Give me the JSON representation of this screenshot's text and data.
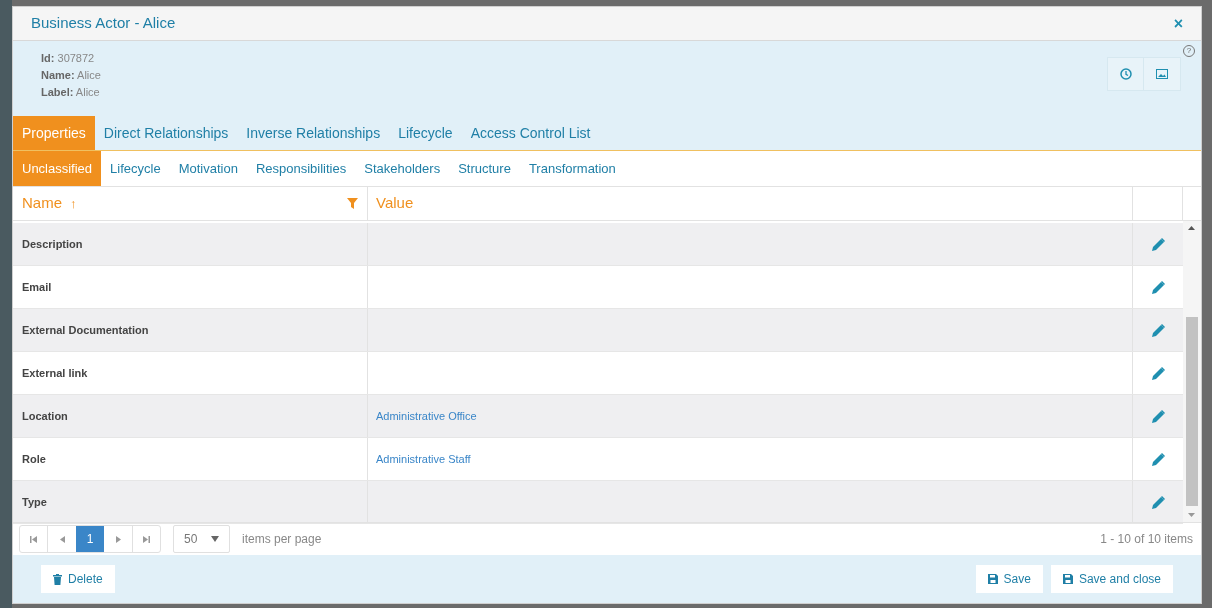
{
  "window": {
    "title": "Business Actor - Alice",
    "close": "×"
  },
  "info": [
    {
      "label": "Id:",
      "value": "307872"
    },
    {
      "label": "Name:",
      "value": "Alice"
    },
    {
      "label": "Label:",
      "value": "Alice"
    }
  ],
  "help": "?",
  "tabs": [
    {
      "label": "Properties",
      "selected": true
    },
    {
      "label": "Direct Relationships",
      "selected": false
    },
    {
      "label": "Inverse Relationships",
      "selected": false
    },
    {
      "label": "Lifecycle",
      "selected": false
    },
    {
      "label": "Access Control List",
      "selected": false
    }
  ],
  "subtabs": [
    {
      "label": "Unclassified",
      "selected": true
    },
    {
      "label": "Lifecycle",
      "selected": false
    },
    {
      "label": "Motivation",
      "selected": false
    },
    {
      "label": "Responsibilities",
      "selected": false
    },
    {
      "label": "Stakeholders",
      "selected": false
    },
    {
      "label": "Structure",
      "selected": false
    },
    {
      "label": "Transformation",
      "selected": false
    }
  ],
  "table": {
    "columns": [
      {
        "label": "Name",
        "sort": "↑"
      },
      {
        "label": "Value"
      }
    ],
    "rows": [
      {
        "name": "Description"
      },
      {
        "name": "Email"
      },
      {
        "name": "External Documentation"
      },
      {
        "name": "External link"
      },
      {
        "name": "Location",
        "value": "Administrative Office"
      },
      {
        "name": "Role",
        "value": "Administrative Staff"
      },
      {
        "name": "Type"
      }
    ]
  },
  "pager": {
    "page": "1",
    "page_size": "50",
    "per_page_label": "items per page",
    "summary": "1 - 10 of 10 items"
  },
  "buttons": {
    "delete": "Delete",
    "save": "Save",
    "save_close": "Save and close"
  }
}
